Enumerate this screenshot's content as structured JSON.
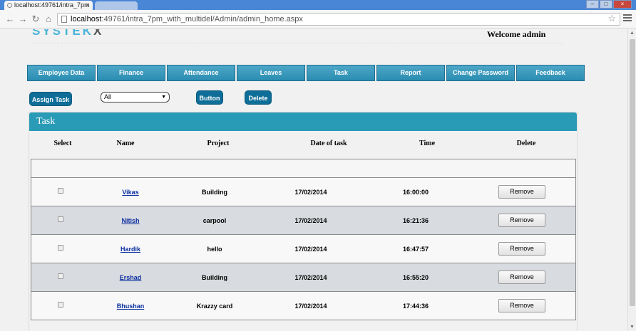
{
  "browser": {
    "tab_title": "localhost:49761/intra_7pm",
    "url_host": "localhost",
    "url_rest": ":49761/intra_7pm_with_multidel/Admin/admin_home.aspx"
  },
  "header": {
    "logo": "SYSTEK",
    "welcome": "Welcome admin"
  },
  "menu": [
    {
      "label": "Employee  Data"
    },
    {
      "label": "Finance"
    },
    {
      "label": "Attendance"
    },
    {
      "label": "Leaves"
    },
    {
      "label": "Task"
    },
    {
      "label": "Report"
    },
    {
      "label": "Change Password"
    },
    {
      "label": "Feedback"
    }
  ],
  "actions": {
    "assign_task": "Assign Task",
    "filter_value": "All",
    "button": "Button",
    "delete": "Delete"
  },
  "panel": {
    "title": "Task",
    "columns": [
      "Select",
      "Name",
      "Project",
      "Date of task",
      "Time",
      "Delete"
    ],
    "rows": [
      {
        "name": "Vikas",
        "project": "Building",
        "date": "17/02/2014",
        "time": "16:00:00",
        "action": "Remove"
      },
      {
        "name": "Nitish",
        "project": "carpool",
        "date": "17/02/2014",
        "time": "16:21:36",
        "action": "Remove"
      },
      {
        "name": "Hardik",
        "project": "hello",
        "date": "17/02/2014",
        "time": "16:47:57",
        "action": "Remove"
      },
      {
        "name": "Ershad",
        "project": "Building",
        "date": "17/02/2014",
        "time": "16:55:20",
        "action": "Remove"
      },
      {
        "name": "Bhushan",
        "project": "Krazzy card",
        "date": "17/02/2014",
        "time": "17:44:36",
        "action": "Remove"
      }
    ]
  }
}
